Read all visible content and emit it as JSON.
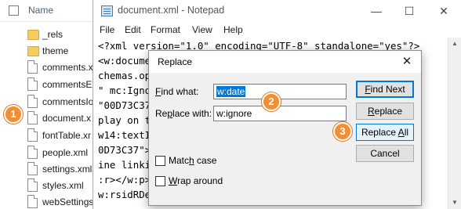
{
  "explorer": {
    "column_header": "Name",
    "items": [
      {
        "label": "_rels",
        "icon": "folder-icon"
      },
      {
        "label": "theme",
        "icon": "folder-icon"
      },
      {
        "label": "comments.x",
        "icon": "file-icon"
      },
      {
        "label": "commentsEx",
        "icon": "file-icon"
      },
      {
        "label": "commentsIo",
        "icon": "file-icon"
      },
      {
        "label": "document.x",
        "icon": "file-icon"
      },
      {
        "label": "fontTable.xr",
        "icon": "file-icon"
      },
      {
        "label": "people.xml",
        "icon": "file-icon"
      },
      {
        "label": "settings.xml",
        "icon": "file-icon"
      },
      {
        "label": "styles.xml",
        "icon": "file-icon"
      },
      {
        "label": "webSettings",
        "icon": "file-icon"
      }
    ]
  },
  "notepad": {
    "title": "document.xml - Notepad",
    "window_buttons": {
      "minimize": "—",
      "maximize": "☐",
      "close": "✕"
    },
    "menu": [
      "File",
      "Edit",
      "Format",
      "View",
      "Help"
    ],
    "lines": [
      "<?xml version=\"1.0\" encoding=\"UTF-8\" standalone=\"yes\"?>",
      "<w:docume                                         offi",
      "chemas.op                                         onsh",
      "\" mc:Igno                                         w:p",
      "\"00D73C37                                         </w:",
      "play on t                                         :t>",
      "w14:textI                                         00D7",
      "0D73C37\">                                         may",
      "ine linki                                          com",
      ":r></w:p>                                         7777",
      "w:rsidRDe                                          C37"
    ]
  },
  "dialog": {
    "title": "Replace",
    "close_glyph": "✕",
    "find_what_label": "Find what:",
    "find_what_value": "w:date",
    "replace_with_label": "Replace with:",
    "replace_with_value": "w:ignore",
    "buttons": {
      "find_next": "Find Next",
      "replace": "Replace",
      "replace_all": "Replace All",
      "cancel": "Cancel"
    },
    "match_case": {
      "label": "Match case",
      "checked": false
    },
    "wrap_around": {
      "label": "Wrap around",
      "checked": false
    }
  },
  "badges": {
    "one": "1",
    "two": "2",
    "three": "3"
  },
  "colors": {
    "badge": "#f28f34",
    "selection": "#0078d7",
    "folder": "#f4cc5f"
  }
}
